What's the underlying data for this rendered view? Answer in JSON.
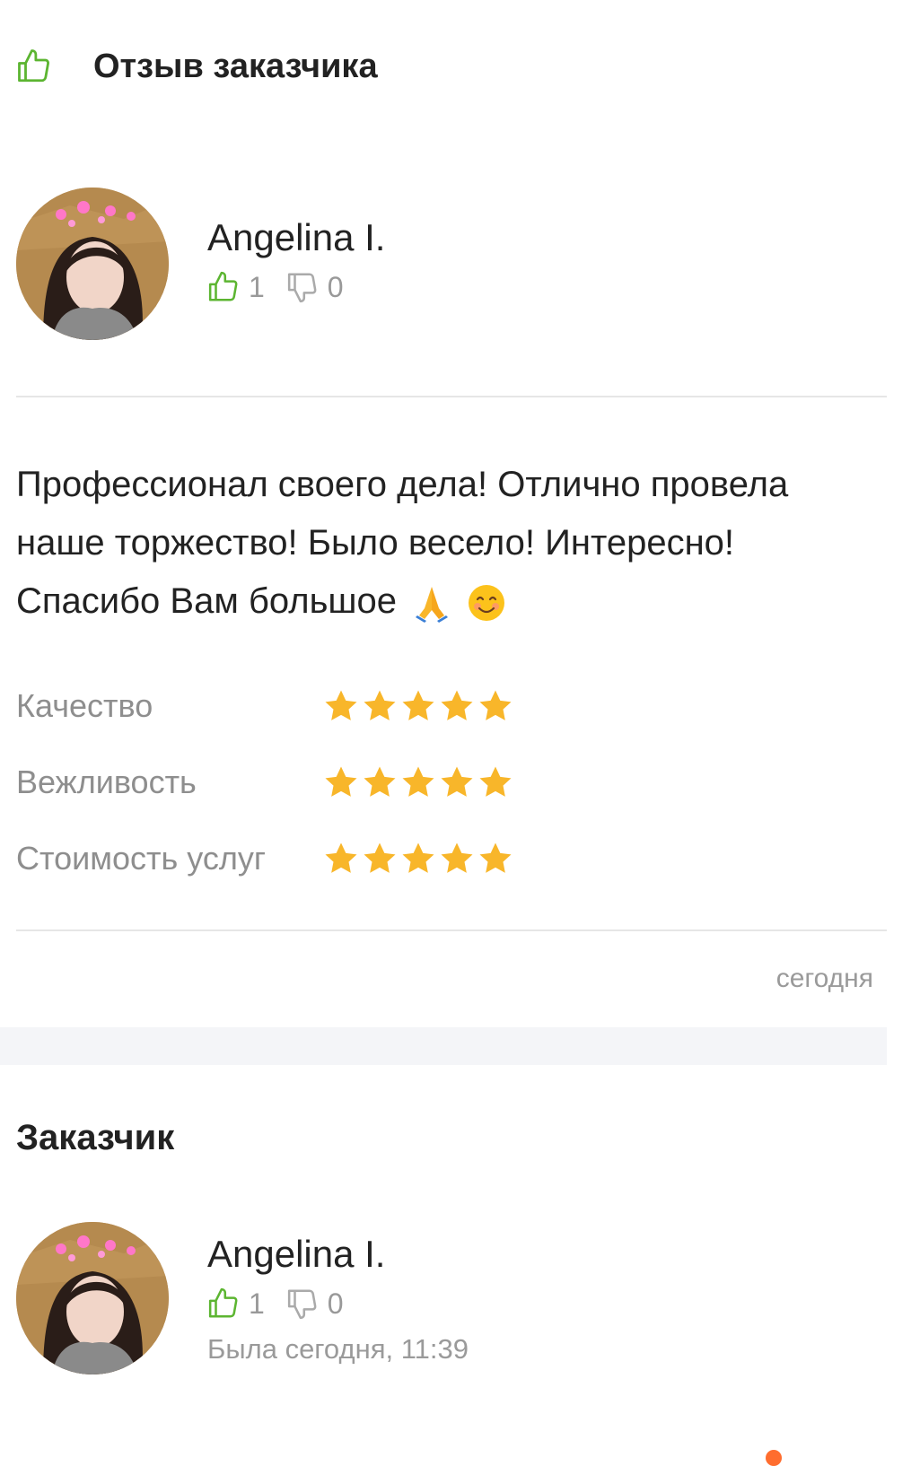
{
  "header": {
    "title": "Отзыв заказчика",
    "icon": "thumbs-up-icon"
  },
  "review": {
    "author": {
      "name": "Angelina I.",
      "likes": "1",
      "dislikes": "0"
    },
    "text_line1": "Профессионал своего дела! Отлично провела",
    "text_line2": "наше торжество! Было весело! Интересно!",
    "text_line3": "Спасибо Вам большое",
    "emojis": [
      "folded-hands-emoji",
      "smiling-face-emoji"
    ],
    "ratings": [
      {
        "label": "Качество",
        "stars": 5,
        "max": 5
      },
      {
        "label": "Вежливость",
        "stars": 5,
        "max": 5
      },
      {
        "label": "Стоимость услуг",
        "stars": 5,
        "max": 5
      }
    ],
    "date": "сегодня"
  },
  "customer": {
    "section_title": "Заказчик",
    "name": "Angelina I.",
    "likes": "1",
    "dislikes": "0",
    "last_seen": "Была сегодня, 11:39"
  },
  "colors": {
    "like_green": "#5cb531",
    "star_yellow": "#f8b62a",
    "muted_gray": "#9a9a9a",
    "accent_orange": "#ff6d2e"
  }
}
